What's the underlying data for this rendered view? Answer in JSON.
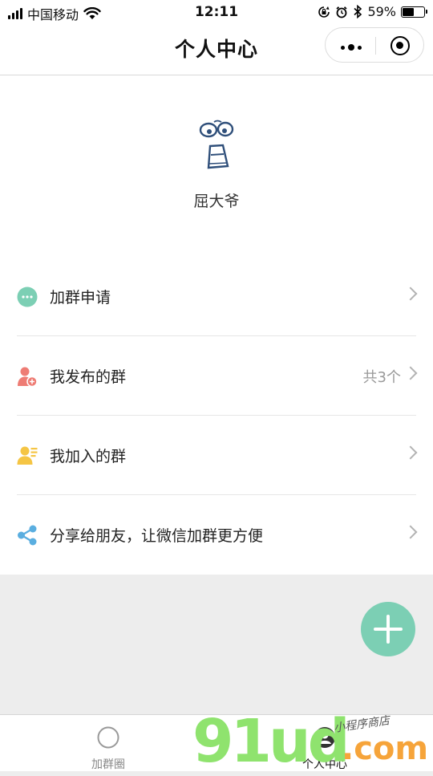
{
  "status_bar": {
    "carrier": "中国移动",
    "time": "12:11",
    "battery_percent": "59%",
    "battery_level": 0.59,
    "icons": [
      "signal-icon",
      "wifi-icon",
      "orientation-lock-icon",
      "alarm-icon",
      "bluetooth-icon",
      "battery-icon"
    ]
  },
  "nav": {
    "title": "个人中心",
    "icons": [
      "more-icon",
      "close-target-icon"
    ]
  },
  "profile": {
    "name": "屈大爷",
    "avatar_icon": "doodle-avatar-icon"
  },
  "menu": {
    "items": [
      {
        "label": "加群申请",
        "extra": "",
        "icon": "chat-bubble-icon",
        "color": "#7ccfb4"
      },
      {
        "label": "我发布的群",
        "extra": "共3个",
        "icon": "user-add-icon",
        "color": "#ee7c74"
      },
      {
        "label": "我加入的群",
        "extra": "",
        "icon": "user-card-icon",
        "color": "#f5c544"
      },
      {
        "label": "分享给朋友，让微信加群更方便",
        "extra": "",
        "icon": "share-icon",
        "color": "#5aaee0"
      }
    ]
  },
  "fab": {
    "icon": "plus-icon",
    "color": "#7ccfb4"
  },
  "tabbar": {
    "tabs": [
      {
        "label": "加群圈",
        "icon": "circle-icon",
        "active": false
      },
      {
        "label": "个人中心",
        "icon": "profile-icon",
        "active": true
      }
    ]
  },
  "watermark": {
    "main": "91ud",
    "suffix": ".com",
    "sub": "小程序商店"
  }
}
